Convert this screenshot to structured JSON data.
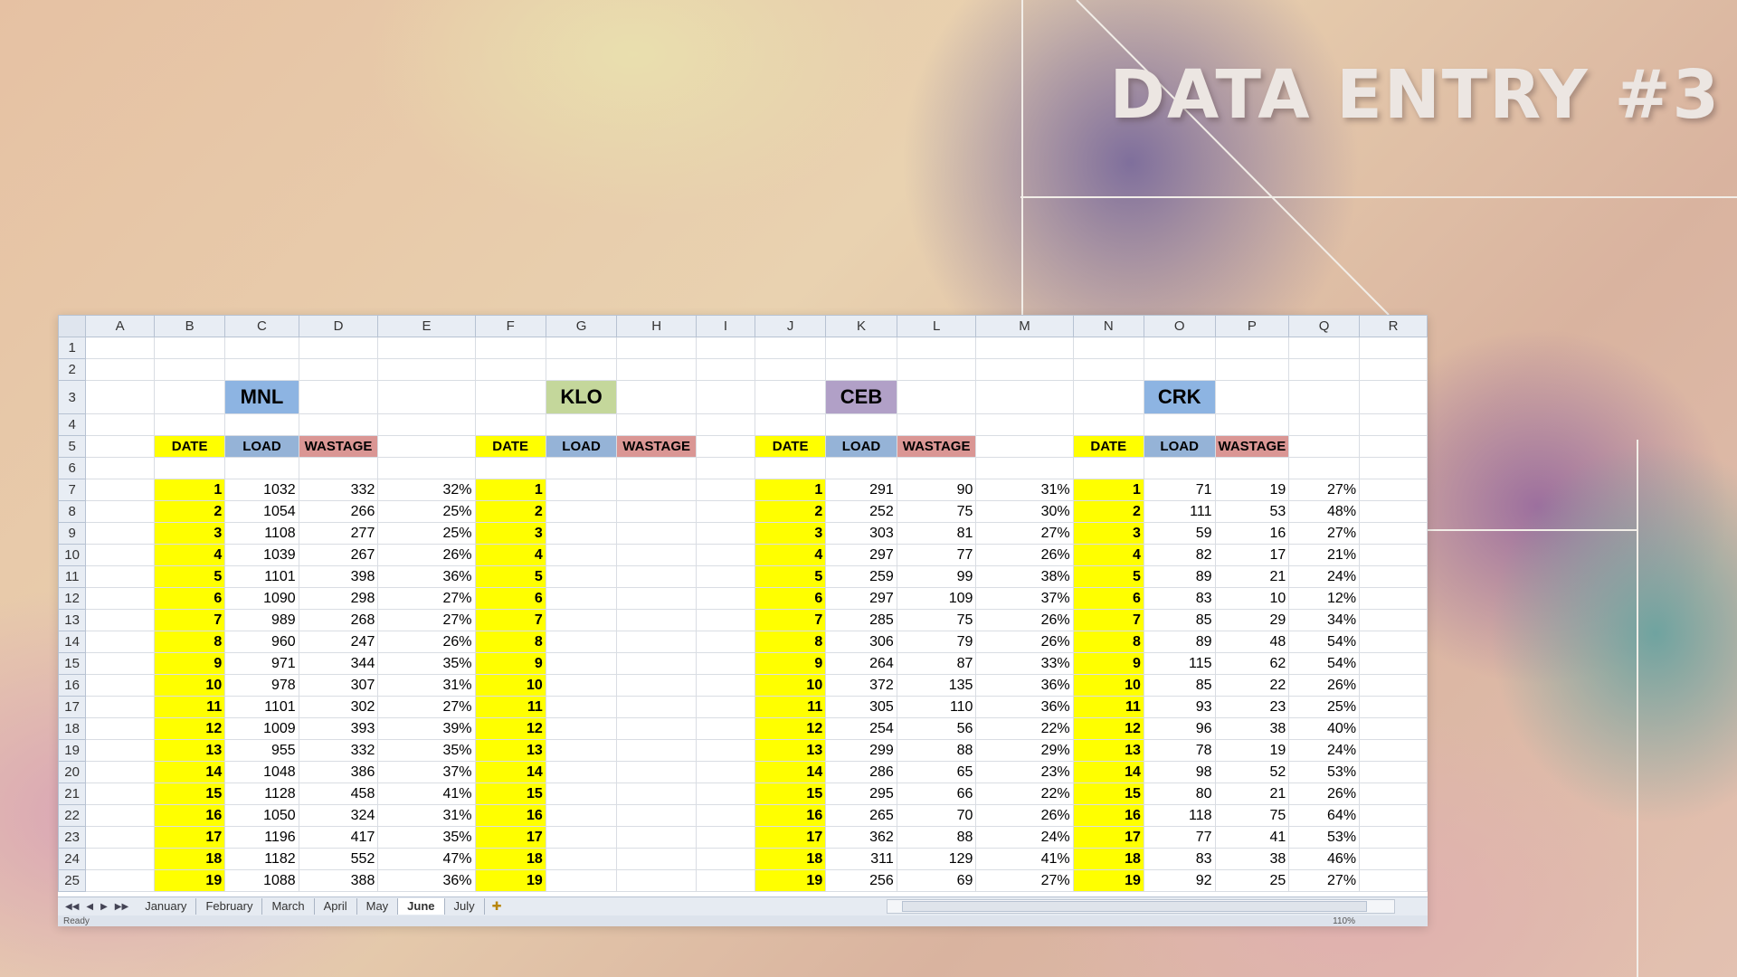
{
  "headline": "DATA ENTRY #3",
  "columns": [
    "A",
    "B",
    "C",
    "D",
    "E",
    "F",
    "G",
    "H",
    "I",
    "J",
    "K",
    "L",
    "M",
    "N",
    "O",
    "P",
    "Q",
    "R"
  ],
  "sections": [
    {
      "title": "MNL",
      "title_color": "#8db4e2"
    },
    {
      "title": "KLO",
      "title_color": "#c4d79b"
    },
    {
      "title": "CEB",
      "title_color": "#b1a0c7"
    },
    {
      "title": "CRK",
      "title_color": "#8db4e2"
    }
  ],
  "headers": {
    "date": "DATE",
    "load": "LOAD",
    "wastage": "WASTAGE"
  },
  "rows": [
    {
      "row": 7,
      "date": 1,
      "mnl": [
        1032,
        332,
        "32%"
      ],
      "ceb": [
        291,
        90,
        "31%"
      ],
      "crk": [
        71,
        19,
        "27%"
      ]
    },
    {
      "row": 8,
      "date": 2,
      "mnl": [
        1054,
        266,
        "25%"
      ],
      "ceb": [
        252,
        75,
        "30%"
      ],
      "crk": [
        111,
        53,
        "48%"
      ]
    },
    {
      "row": 9,
      "date": 3,
      "mnl": [
        1108,
        277,
        "25%"
      ],
      "ceb": [
        303,
        81,
        "27%"
      ],
      "crk": [
        59,
        16,
        "27%"
      ]
    },
    {
      "row": 10,
      "date": 4,
      "mnl": [
        1039,
        267,
        "26%"
      ],
      "ceb": [
        297,
        77,
        "26%"
      ],
      "crk": [
        82,
        17,
        "21%"
      ]
    },
    {
      "row": 11,
      "date": 5,
      "mnl": [
        1101,
        398,
        "36%"
      ],
      "ceb": [
        259,
        99,
        "38%"
      ],
      "crk": [
        89,
        21,
        "24%"
      ]
    },
    {
      "row": 12,
      "date": 6,
      "mnl": [
        1090,
        298,
        "27%"
      ],
      "ceb": [
        297,
        109,
        "37%"
      ],
      "crk": [
        83,
        10,
        "12%"
      ]
    },
    {
      "row": 13,
      "date": 7,
      "mnl": [
        989,
        268,
        "27%"
      ],
      "ceb": [
        285,
        75,
        "26%"
      ],
      "crk": [
        85,
        29,
        "34%"
      ]
    },
    {
      "row": 14,
      "date": 8,
      "mnl": [
        960,
        247,
        "26%"
      ],
      "ceb": [
        306,
        79,
        "26%"
      ],
      "crk": [
        89,
        48,
        "54%"
      ]
    },
    {
      "row": 15,
      "date": 9,
      "mnl": [
        971,
        344,
        "35%"
      ],
      "ceb": [
        264,
        87,
        "33%"
      ],
      "crk": [
        115,
        62,
        "54%"
      ]
    },
    {
      "row": 16,
      "date": 10,
      "mnl": [
        978,
        307,
        "31%"
      ],
      "ceb": [
        372,
        135,
        "36%"
      ],
      "crk": [
        85,
        22,
        "26%"
      ]
    },
    {
      "row": 17,
      "date": 11,
      "mnl": [
        1101,
        302,
        "27%"
      ],
      "ceb": [
        305,
        110,
        "36%"
      ],
      "crk": [
        93,
        23,
        "25%"
      ]
    },
    {
      "row": 18,
      "date": 12,
      "mnl": [
        1009,
        393,
        "39%"
      ],
      "ceb": [
        254,
        56,
        "22%"
      ],
      "crk": [
        96,
        38,
        "40%"
      ]
    },
    {
      "row": 19,
      "date": 13,
      "mnl": [
        955,
        332,
        "35%"
      ],
      "ceb": [
        299,
        88,
        "29%"
      ],
      "crk": [
        78,
        19,
        "24%"
      ]
    },
    {
      "row": 20,
      "date": 14,
      "mnl": [
        1048,
        386,
        "37%"
      ],
      "ceb": [
        286,
        65,
        "23%"
      ],
      "crk": [
        98,
        52,
        "53%"
      ]
    },
    {
      "row": 21,
      "date": 15,
      "mnl": [
        1128,
        458,
        "41%"
      ],
      "ceb": [
        295,
        66,
        "22%"
      ],
      "crk": [
        80,
        21,
        "26%"
      ]
    },
    {
      "row": 22,
      "date": 16,
      "mnl": [
        1050,
        324,
        "31%"
      ],
      "ceb": [
        265,
        70,
        "26%"
      ],
      "crk": [
        118,
        75,
        "64%"
      ]
    },
    {
      "row": 23,
      "date": 17,
      "mnl": [
        1196,
        417,
        "35%"
      ],
      "ceb": [
        362,
        88,
        "24%"
      ],
      "crk": [
        77,
        41,
        "53%"
      ]
    },
    {
      "row": 24,
      "date": 18,
      "mnl": [
        1182,
        552,
        "47%"
      ],
      "ceb": [
        311,
        129,
        "41%"
      ],
      "crk": [
        83,
        38,
        "46%"
      ]
    },
    {
      "row": 25,
      "date": 19,
      "mnl": [
        1088,
        388,
        "36%"
      ],
      "ceb": [
        256,
        69,
        "27%"
      ],
      "crk": [
        92,
        25,
        "27%"
      ]
    }
  ],
  "sheet_tabs": [
    "January",
    "February",
    "March",
    "April",
    "May",
    "June",
    "July"
  ],
  "active_tab": "June",
  "status": {
    "text": "Ready",
    "zoom": "110%"
  }
}
